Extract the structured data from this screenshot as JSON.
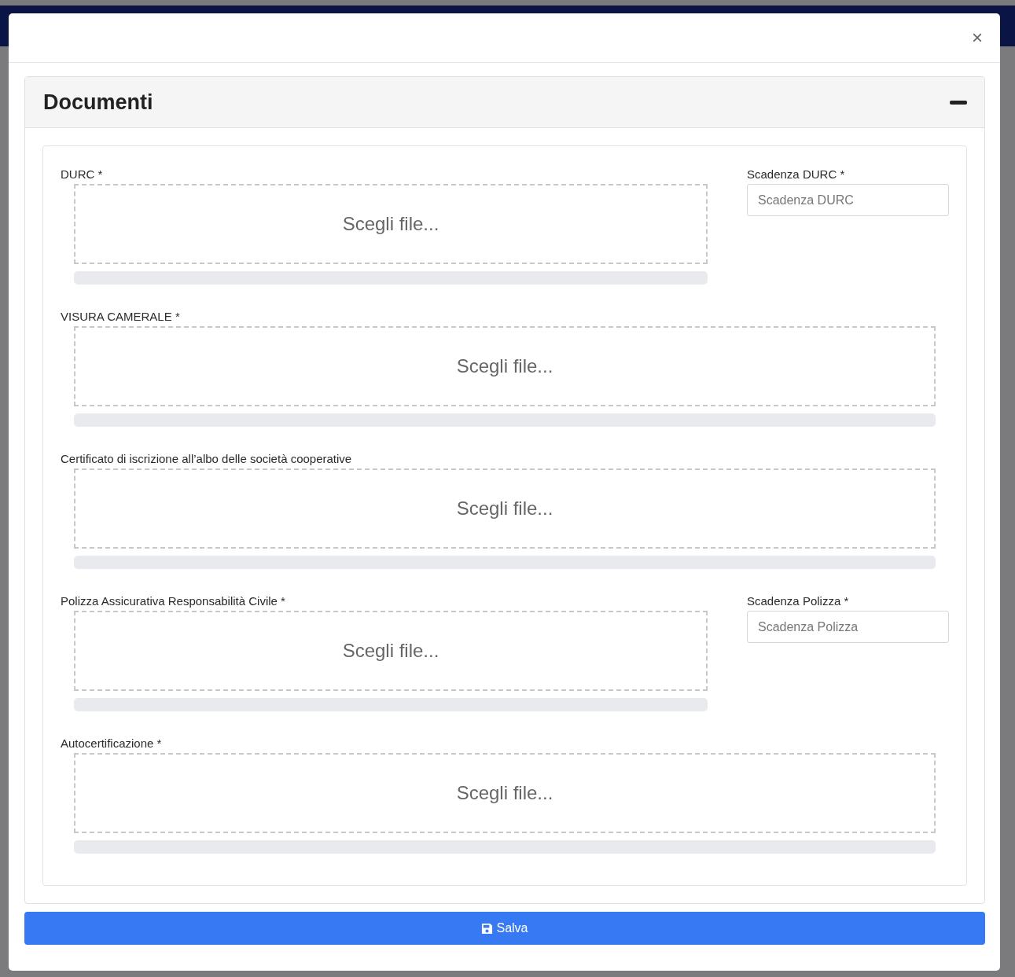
{
  "modal": {
    "close": "×"
  },
  "card": {
    "title": "Documenti",
    "expanded": true
  },
  "documents": [
    {
      "label": "DURC *",
      "dropzone": "Scegli file...",
      "level": 0,
      "date_field": {
        "label": "Scadenza DURC *",
        "placeholder": "Scadenza DURC"
      }
    },
    {
      "label": "VISURA CAMERALE *",
      "dropzone": "Scegli file...",
      "level": 0
    },
    {
      "label": "Certificato di iscrizione all’albo delle società cooperative",
      "dropzone": "Scegli file...",
      "level": 0
    },
    {
      "label": "Polizza Assicurativa Responsabilità Civile *",
      "dropzone": "Scegli file...",
      "level": 0,
      "date_field": {
        "label": "Scadenza Polizza *",
        "placeholder": "Scadenza Polizza"
      }
    },
    {
      "label": "Autocertificazione *",
      "dropzone": "Scegli file...",
      "level": 0
    }
  ],
  "save_button": "Salva"
}
